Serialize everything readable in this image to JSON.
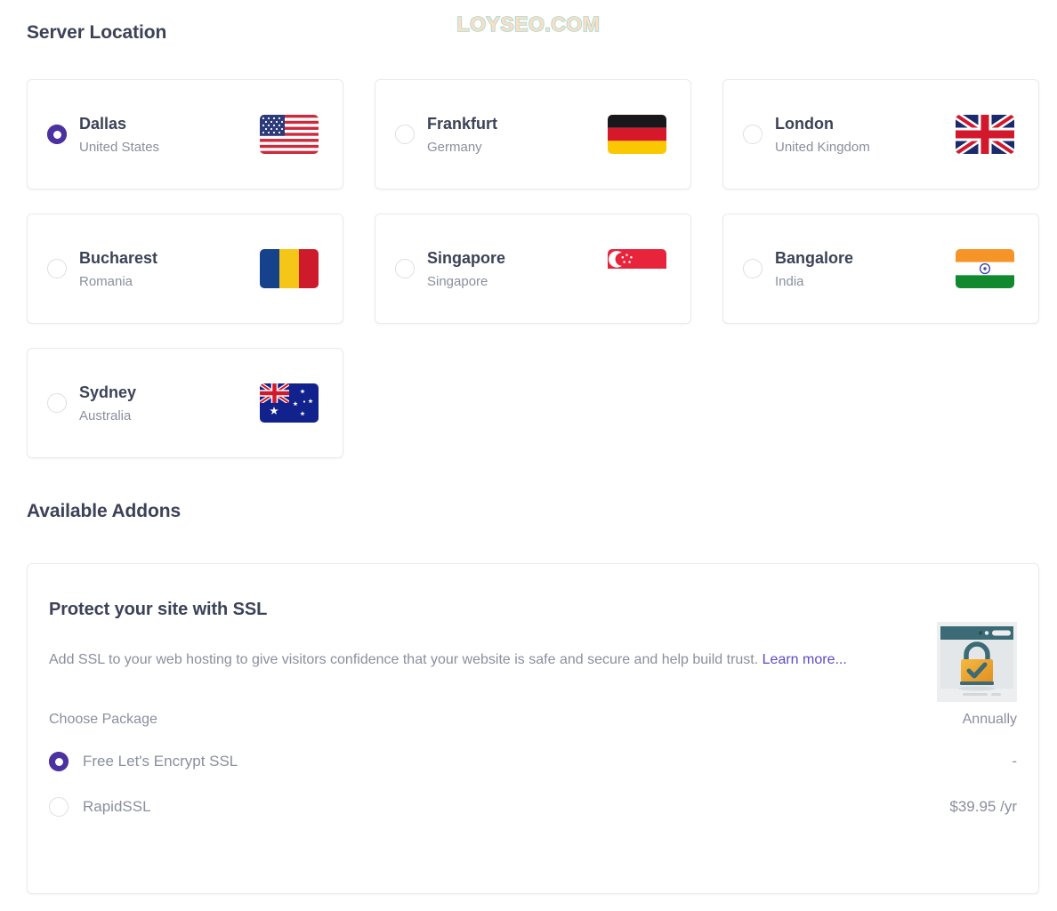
{
  "watermark": "LOYSEO.COM",
  "sections": {
    "server_location_title": "Server Location",
    "addons_title": "Available Addons"
  },
  "locations": [
    {
      "city": "Dallas",
      "country": "United States",
      "flag": "flag-us",
      "selected": true
    },
    {
      "city": "Frankfurt",
      "country": "Germany",
      "flag": "flag-de",
      "selected": false
    },
    {
      "city": "London",
      "country": "United Kingdom",
      "flag": "flag-gb",
      "selected": false
    },
    {
      "city": "Bucharest",
      "country": "Romania",
      "flag": "flag-ro",
      "selected": false
    },
    {
      "city": "Singapore",
      "country": "Singapore",
      "flag": "flag-sg",
      "selected": false
    },
    {
      "city": "Bangalore",
      "country": "India",
      "flag": "flag-in",
      "selected": false
    },
    {
      "city": "Sydney",
      "country": "Australia",
      "flag": "flag-au",
      "selected": false
    }
  ],
  "addon": {
    "title": "Protect your site with SSL",
    "description": "Add SSL to your web hosting to give visitors confidence that your website is safe and secure and help build trust.",
    "link_label": "Learn more...",
    "badge_icon": "ssl-lock-browser-icon",
    "choose_package_label": "Choose Package",
    "billing_cycle_label": "Annually",
    "packages": [
      {
        "name": "Free Let's Encrypt SSL",
        "price": "-",
        "selected": true
      },
      {
        "name": "RapidSSL",
        "price": "$39.95 /yr",
        "selected": false
      }
    ]
  },
  "colors": {
    "accent": "#4c32a0",
    "link": "#5b4bc4",
    "heading": "#3c4257",
    "muted": "#8a8f9e",
    "card_border": "#e8eaee"
  }
}
